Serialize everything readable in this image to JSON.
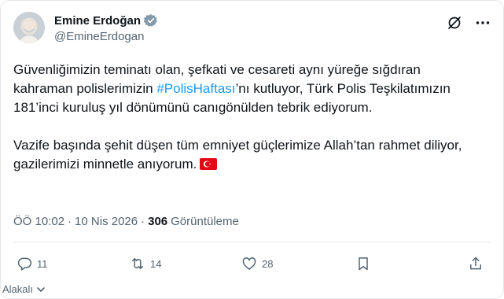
{
  "user": {
    "display_name": "Emine Erdoğan",
    "handle": "@EmineErdogan"
  },
  "tweet": {
    "line1_before": "Güvenliğimizin teminatı olan, şefkati ve cesareti aynı yüreğe sığdıran kahraman polislerimizin ",
    "hashtag": "#PolisHaftası",
    "line1_after": "’nı kutluyor, Türk Polis Teşkilatımızın 181’inci kuruluş yıl dönümünü canıgönülden tebrik ediyorum.",
    "paragraph2": "Vazife başında şehit düşen tüm emniyet güçlerimize Allah’tan rahmet diliyor, gazilerimizi minnetle anıyorum."
  },
  "meta": {
    "time": "ÖÖ 10:02",
    "sep1": "·",
    "date": "10 Nis 2026",
    "sep2": "·",
    "views_count": "306",
    "views_label": "Görüntüleme"
  },
  "actions": {
    "replies": "11",
    "reposts": "14",
    "likes": "28"
  },
  "translate": {
    "label": "Alakalı"
  },
  "icons": {
    "verified": "verified-badge-icon",
    "grok": "slash-circle-icon",
    "more": "more-dots-icon",
    "reply": "reply-icon",
    "repost": "repost-icon",
    "like": "heart-icon",
    "bookmark": "bookmark-icon",
    "share": "share-icon",
    "flag": "turkey-flag-icon"
  },
  "colors": {
    "accent": "#1d9bf0",
    "muted": "#536471",
    "text": "#0f1419",
    "flag_red": "#e30a17"
  }
}
